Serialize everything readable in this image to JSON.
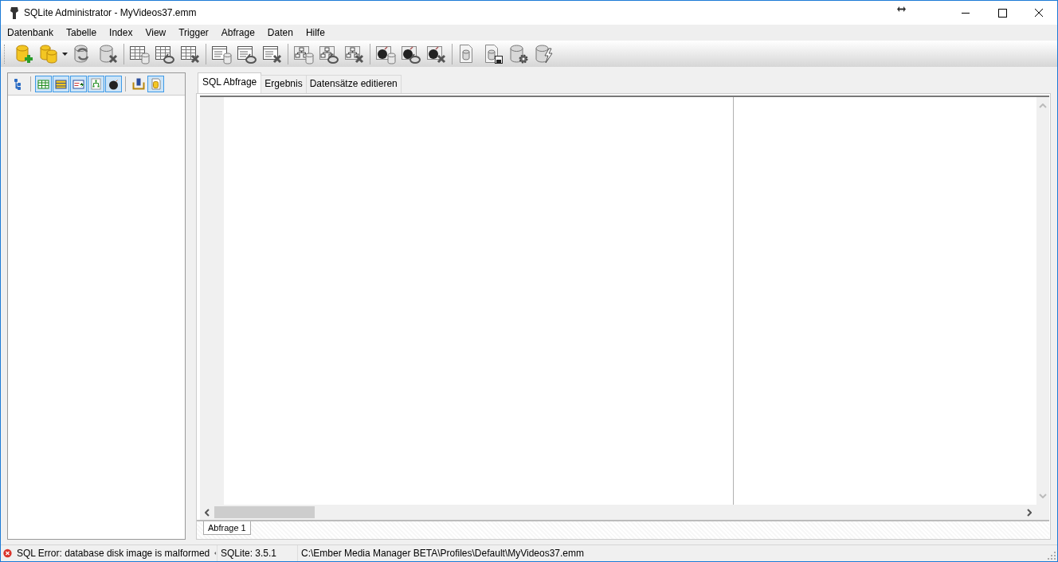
{
  "window": {
    "title": "SQLite Administrator - MyVideos37.emm"
  },
  "menu": [
    "Datenbank",
    "Tabelle",
    "Index",
    "View",
    "Trigger",
    "Abfrage",
    "Daten",
    "Hilfe"
  ],
  "side_toolbar": [
    {
      "selected": false
    },
    {
      "selected": true
    },
    {
      "selected": true
    },
    {
      "selected": true
    },
    {
      "selected": true
    },
    {
      "selected": true
    },
    {
      "selected": false
    },
    {
      "selected": true
    }
  ],
  "tabs": [
    {
      "label": "SQL Abfrage",
      "selected": true
    },
    {
      "label": "Ergebnis",
      "selected": false
    },
    {
      "label": "Datensätze editieren",
      "selected": false
    }
  ],
  "query_tabs": [
    {
      "label": "Abfrage 1",
      "selected": true
    }
  ],
  "status_bar": {
    "message": "SQL Error: database disk image is malformed",
    "version": "SQLite: 3.5.1",
    "path": "C:\\Ember Media Manager BETA\\Profiles\\Default\\MyVideos37.emm"
  }
}
